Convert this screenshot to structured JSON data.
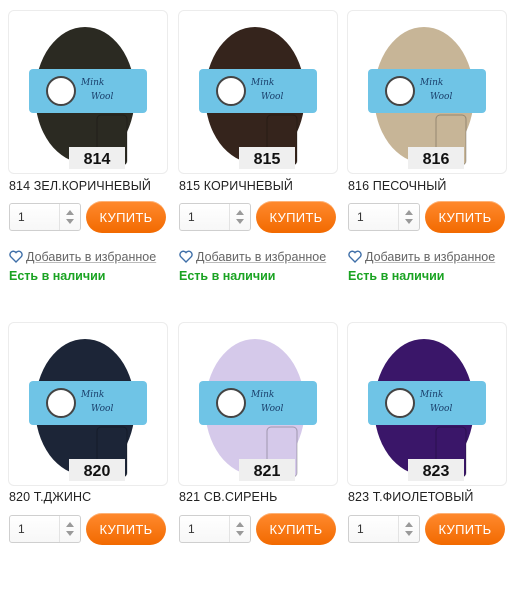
{
  "products": [
    {
      "name": "814 ЗЕЛ.КОРИЧНЕВЫЙ",
      "code": "814",
      "color": "#2b2a22",
      "qty": "1",
      "buy": "КУПИТЬ",
      "fav": "Добавить в избранное",
      "stock": "Есть в наличии",
      "badge_text": [
        "Mink",
        "Wool"
      ]
    },
    {
      "name": "815 КОРИЧНЕВЫЙ",
      "code": "815",
      "color": "#35241c",
      "qty": "1",
      "buy": "КУПИТЬ",
      "fav": "Добавить в избранное",
      "stock": "Есть в наличии",
      "badge_text": [
        "Mink",
        "Wool"
      ]
    },
    {
      "name": "816 ПЕСОЧНЫЙ",
      "code": "816",
      "color": "#c7b597",
      "qty": "1",
      "buy": "КУПИТЬ",
      "fav": "Добавить в избранное",
      "stock": "Есть в наличии",
      "badge_text": [
        "Mink",
        "Wool"
      ]
    },
    {
      "name": "820 Т.ДЖИНС",
      "code": "820",
      "color": "#1c2537",
      "qty": "1",
      "buy": "КУПИТЬ",
      "badge_text": [
        "Mink",
        "Wool"
      ]
    },
    {
      "name": "821 СВ.СИРЕНЬ",
      "code": "821",
      "color": "#d5c9ea",
      "qty": "1",
      "buy": "КУПИТЬ",
      "badge_text": [
        "Mink",
        "Wool"
      ]
    },
    {
      "name": "823 Т.ФИОЛЕТОВЫЙ",
      "code": "823",
      "color": "#3a1669",
      "qty": "1",
      "buy": "КУПИТЬ",
      "badge_text": [
        "Mink",
        "Wool"
      ]
    }
  ],
  "colors": {
    "accent": "#f26a00",
    "in_stock": "#1aa322",
    "label_band": "#6fc4e6"
  },
  "icons": {
    "favorite": "heart-outline-icon"
  }
}
